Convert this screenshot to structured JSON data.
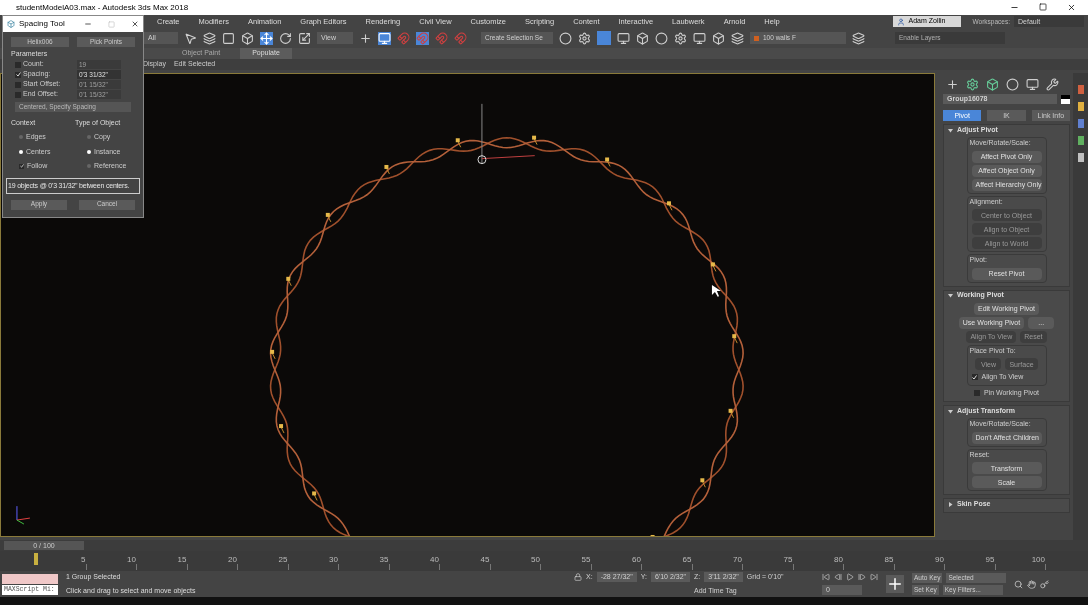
{
  "title_bar": {
    "title": "studentModelA03.max - Autodesk 3ds Max 2018"
  },
  "menu": [
    "Create",
    "Modifiers",
    "Animation",
    "Graph Editors",
    "Rendering",
    "Civil View",
    "Customize",
    "Scripting",
    "Content",
    "Interactive",
    "Laubwerk",
    "Arnold",
    "Help"
  ],
  "account": {
    "user": "Adam Zollin",
    "workspaces_label": "Workspaces:",
    "workspace": "Default"
  },
  "toolbar": {
    "selection_filter": "All",
    "ref_coord": "View",
    "named_selection": "Create Selection Se",
    "layer": "100 walls F",
    "layer_field": "Enable Layers"
  },
  "ribbon_tabs": [
    {
      "label": "Object Paint",
      "selected": false
    },
    {
      "label": "Populate",
      "selected": true
    }
  ],
  "sub_tabs": [
    "Display",
    "Edit Selected"
  ],
  "spacing_tool": {
    "title": "Spacing Tool",
    "buttons": [
      "Helix006",
      "Pick Points"
    ],
    "parameters_label": "Parameters",
    "params": [
      {
        "label": "Count:",
        "checked": false,
        "value": "19"
      },
      {
        "label": "Spacing:",
        "checked": true,
        "value": "0'3 31/32\""
      },
      {
        "label": "Start Offset:",
        "checked": false,
        "value": "0'1 15/32\""
      },
      {
        "label": "End Offset:",
        "checked": false,
        "value": "0'1 15/32\""
      }
    ],
    "mode": "Centered, Specify Spacing",
    "context_label": "Context",
    "context": [
      {
        "label": "Edges",
        "selected": false
      },
      {
        "label": "Centers",
        "selected": true
      }
    ],
    "follow": {
      "label": "Follow",
      "checked": true
    },
    "type_label": "Type of Object",
    "types": [
      {
        "label": "Copy",
        "selected": false
      },
      {
        "label": "Instance",
        "selected": true
      },
      {
        "label": "Reference",
        "selected": false
      }
    ],
    "status": "19 objects @ 0'3 31/32\" between centers.",
    "actions": [
      "Apply",
      "Cancel"
    ]
  },
  "command_panel": {
    "object_name": "Group16078",
    "tabs": [
      {
        "label": "Pivot",
        "selected": true
      },
      {
        "label": "IK",
        "selected": false
      },
      {
        "label": "Link Info",
        "selected": false
      }
    ],
    "rollouts": [
      {
        "title": "Adjust Pivot",
        "expanded": true,
        "items": [
          {
            "kind": "group",
            "label": "Move/Rotate/Scale:",
            "items": [
              {
                "kind": "button",
                "label": "Affect Pivot Only",
                "disabled": false
              },
              {
                "kind": "button",
                "label": "Affect Object Only",
                "disabled": false
              },
              {
                "kind": "button",
                "label": "Affect Hierarchy Only",
                "disabled": false
              }
            ]
          },
          {
            "kind": "group",
            "label": "Alignment:",
            "items": [
              {
                "kind": "button",
                "label": "Center to Object",
                "disabled": true
              },
              {
                "kind": "button",
                "label": "Align to Object",
                "disabled": true
              },
              {
                "kind": "button",
                "label": "Align to World",
                "disabled": true
              }
            ]
          },
          {
            "kind": "group",
            "label": "Pivot:",
            "items": [
              {
                "kind": "button",
                "label": "Reset Pivot",
                "disabled": false
              }
            ]
          }
        ]
      },
      {
        "title": "Working Pivot",
        "expanded": true,
        "items": [
          {
            "kind": "button",
            "label": "Edit Working Pivot",
            "disabled": false
          },
          {
            "kind": "row",
            "items": [
              {
                "kind": "button",
                "label": "Use Working Pivot",
                "disabled": false
              },
              {
                "kind": "button",
                "label": "...",
                "disabled": false
              }
            ]
          },
          {
            "kind": "row",
            "items": [
              {
                "kind": "button",
                "label": "Align To View",
                "disabled": true
              },
              {
                "kind": "button",
                "label": "Reset",
                "disabled": true
              }
            ]
          },
          {
            "kind": "group",
            "label": "Place Pivot To:",
            "items": [
              {
                "kind": "row",
                "items": [
                  {
                    "kind": "button",
                    "label": "View",
                    "disabled": true
                  },
                  {
                    "kind": "button",
                    "label": "Surface",
                    "disabled": true
                  }
                ]
              },
              {
                "kind": "checkbox",
                "label": "Align To View",
                "checked": true
              }
            ]
          },
          {
            "kind": "checkbox",
            "label": "Pin Working Pivot",
            "checked": false
          }
        ]
      },
      {
        "title": "Adjust Transform",
        "expanded": true,
        "items": [
          {
            "kind": "group",
            "label": "Move/Rotate/Scale:",
            "items": [
              {
                "kind": "button",
                "label": "Don't Affect Children",
                "disabled": false
              }
            ]
          },
          {
            "kind": "group",
            "label": "Reset:",
            "items": [
              {
                "kind": "button",
                "label": "Transform",
                "disabled": false
              },
              {
                "kind": "button",
                "label": "Scale",
                "disabled": false
              }
            ]
          }
        ]
      },
      {
        "title": "Skin Pose",
        "expanded": false
      }
    ]
  },
  "timeline": {
    "frame_counter": "0 / 100",
    "level": 0,
    "ticks": [
      "5",
      "10",
      "15",
      "20",
      "25",
      "30",
      "35",
      "40",
      "45",
      "50",
      "55",
      "60",
      "65",
      "70",
      "75",
      "80",
      "85",
      "90",
      "95",
      "100"
    ]
  },
  "status_bar": {
    "maxscript": "MAXScript Mi:",
    "selection": "1 Group Selected",
    "prompt": "Click and drag to select and move objects",
    "x_label": "X:",
    "x": "-28 27/32\"",
    "y_label": "Y:",
    "y": "6'10 2/32\"",
    "z_label": "Z:",
    "z": "3'11 2/32\"",
    "grid": "Grid = 0'10\"",
    "time_tag": "Add Time Tag",
    "auto_key": "Auto Key",
    "key_mode": "Selected",
    "set_key": "Set Key",
    "key_filters": "Key Filters...",
    "frame": "0"
  }
}
